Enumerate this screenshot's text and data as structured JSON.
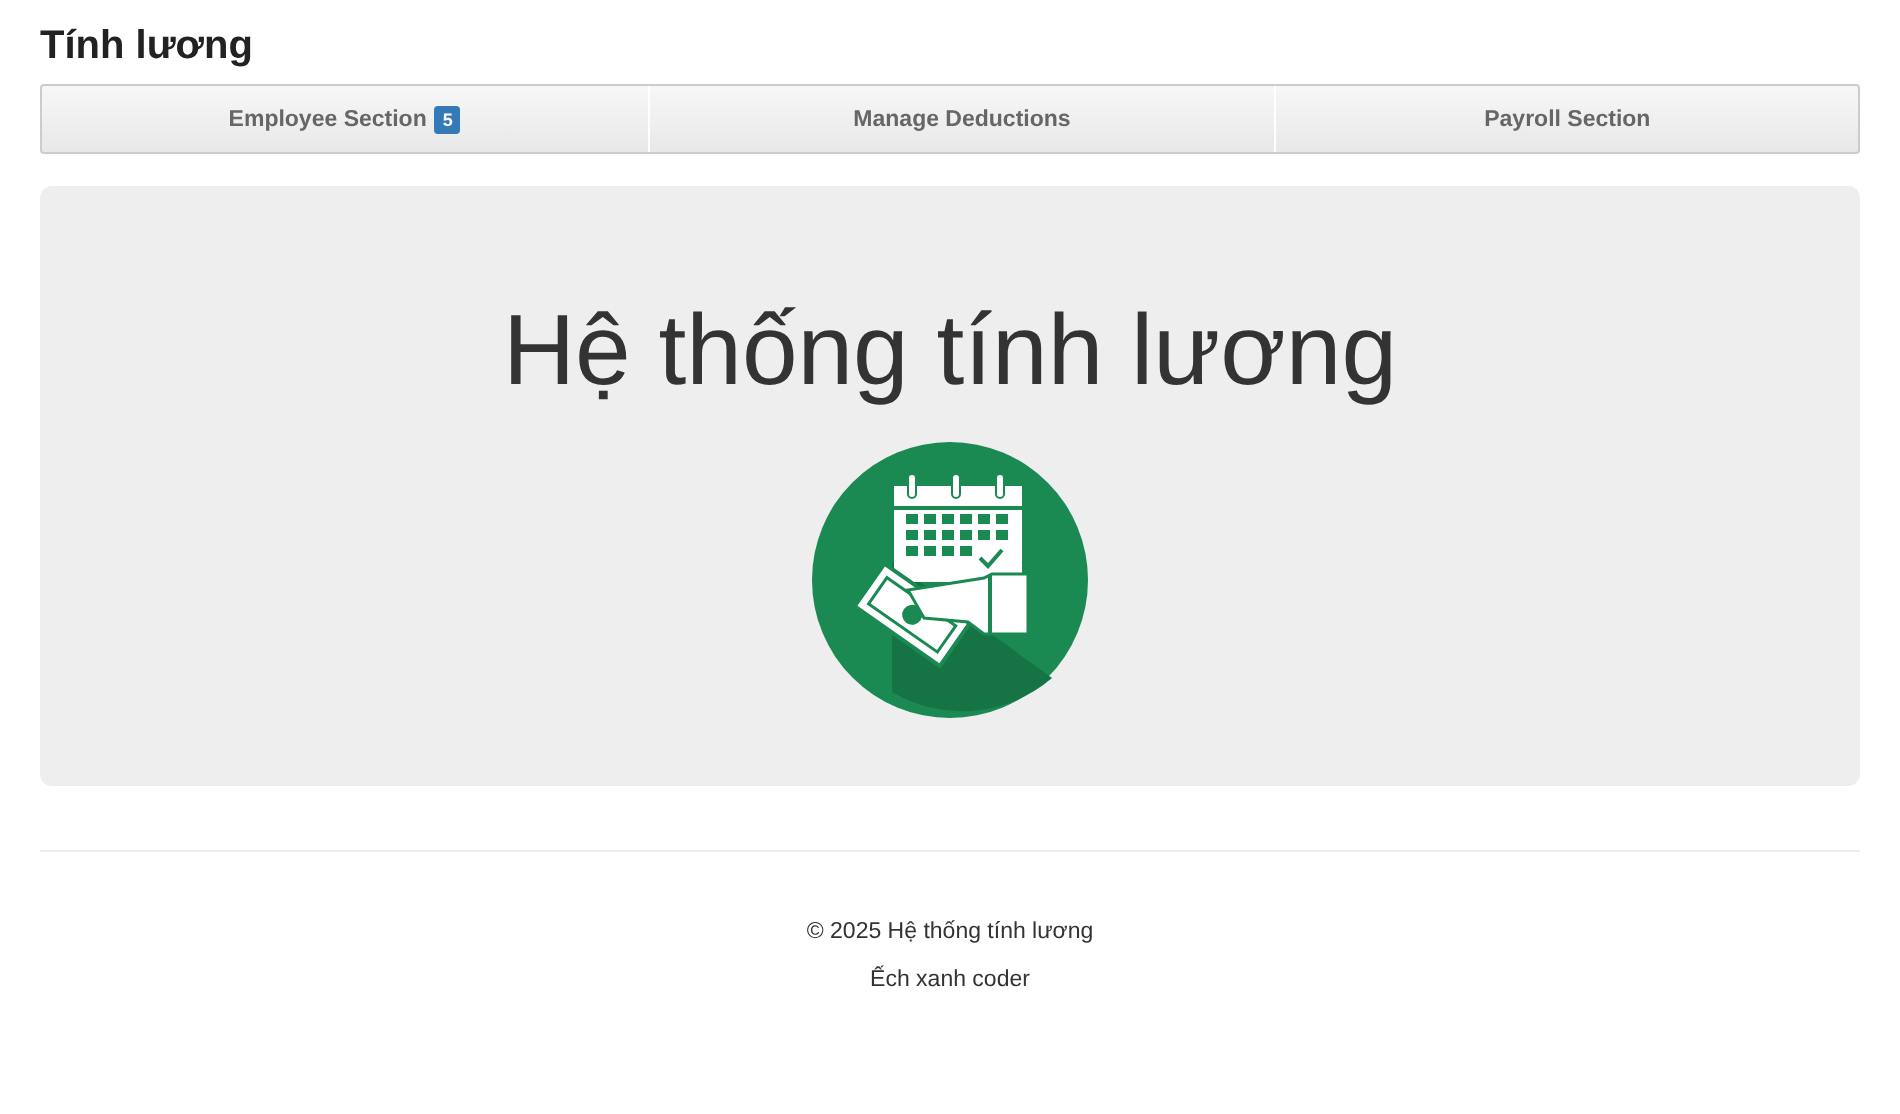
{
  "header": {
    "title": "Tính lương"
  },
  "nav": [
    {
      "label": "Employee Section",
      "badge": "5"
    },
    {
      "label": "Manage Deductions"
    },
    {
      "label": "Payroll Section"
    }
  ],
  "hero": {
    "heading": "Hệ thống tính lương"
  },
  "footer": {
    "lines": [
      "© 2025 Hệ thống tính lương",
      "Ếch xanh coder"
    ]
  }
}
